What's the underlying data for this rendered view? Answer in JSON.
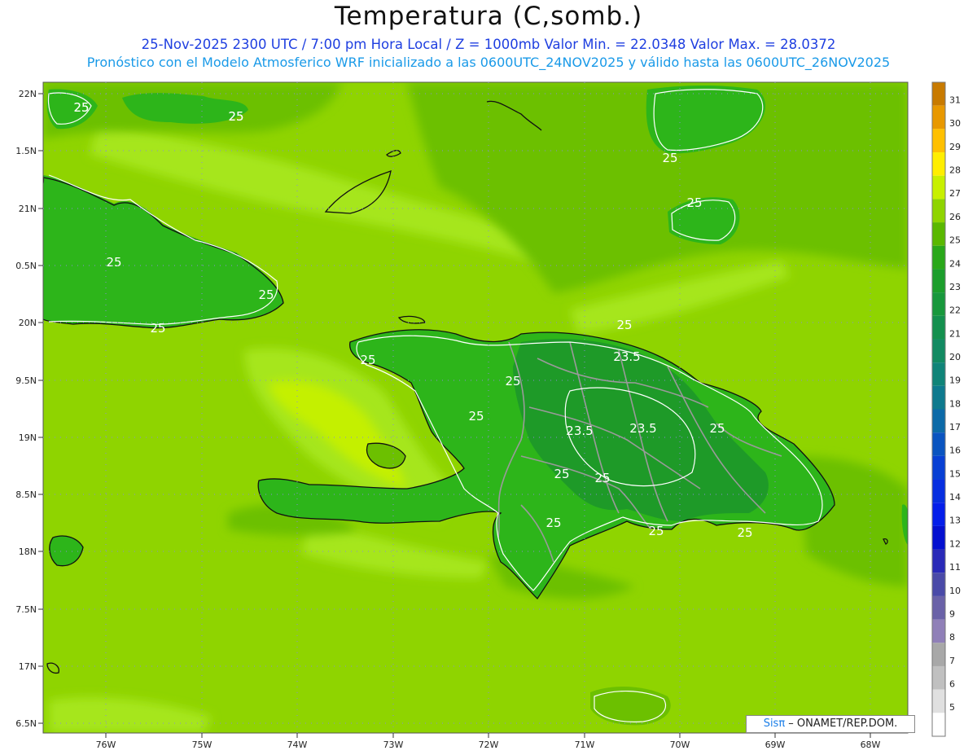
{
  "header": {
    "title": "Temperatura (C,somb.)",
    "subtitle_line1": "25-Nov-2025  2300 UTC / 7:00 pm Hora Local / Z = 1000mb   Valor Min. = 22.0348  Valor Max. = 28.0372",
    "subtitle_line2": "Pronóstico con el Modelo Atmosferico WRF inicializado a las 0600UTC_24NOV2025 y válido hasta las  0600UTC_26NOV2025"
  },
  "map": {
    "lat_labels": [
      "22N",
      "1.5N",
      "21N",
      "0.5N",
      "20N",
      "9.5N",
      "19N",
      "8.5N",
      "18N",
      "7.5N",
      "17N",
      "6.5N"
    ],
    "lon_labels": [
      "76W",
      "75W",
      "74W",
      "73W",
      "72W",
      "71W",
      "70W",
      "69W",
      "68W"
    ],
    "contour_labels": [
      {
        "text": "25"
      },
      {
        "text": "25"
      },
      {
        "text": "25"
      },
      {
        "text": "25"
      },
      {
        "text": "25"
      },
      {
        "text": "25"
      },
      {
        "text": "25"
      },
      {
        "text": "25"
      },
      {
        "text": "25"
      },
      {
        "text": "25"
      },
      {
        "text": "25"
      },
      {
        "text": "23.5"
      },
      {
        "text": "25"
      },
      {
        "text": "23.5"
      },
      {
        "text": "23.5"
      },
      {
        "text": "25"
      },
      {
        "text": "25"
      },
      {
        "text": "25"
      },
      {
        "text": "25"
      },
      {
        "text": "25"
      },
      {
        "text": "25"
      },
      {
        "text": "25"
      }
    ],
    "colors": {
      "sea": "#8fd400",
      "warm_band": "#a6e61e",
      "warmest": "#c4f000",
      "land_green": "#2db51a",
      "land_dark": "#1e9a28",
      "coast": "#111111",
      "border": "#9a9a9a",
      "contour": "#ffffff"
    }
  },
  "colorbar": {
    "labels": [
      "31",
      "30",
      "29",
      "28",
      "27",
      "26",
      "25",
      "24",
      "23",
      "22",
      "21",
      "20",
      "19",
      "18",
      "17",
      "16",
      "15",
      "14",
      "13",
      "12",
      "11",
      "10",
      "9",
      "8",
      "7",
      "6",
      "5"
    ],
    "colors": [
      "#c87a00",
      "#e89800",
      "#ffc000",
      "#ffee00",
      "#c8f000",
      "#8fd400",
      "#5ab800",
      "#2aa81a",
      "#1c9e2c",
      "#18983c",
      "#14904e",
      "#128a62",
      "#108478",
      "#0e7a8e",
      "#0c6aa8",
      "#0a54c0",
      "#0840d4",
      "#062ee0",
      "#041eea",
      "#0410d0",
      "#2a2ab8",
      "#4a4aa8",
      "#6a62a8",
      "#9080b8",
      "#a8a8a8",
      "#c0c0c0",
      "#e0e0e0",
      "#ffffff"
    ]
  },
  "credit": {
    "sis": "Sisπ",
    "rest": " – ONAMET/REP.DOM."
  }
}
